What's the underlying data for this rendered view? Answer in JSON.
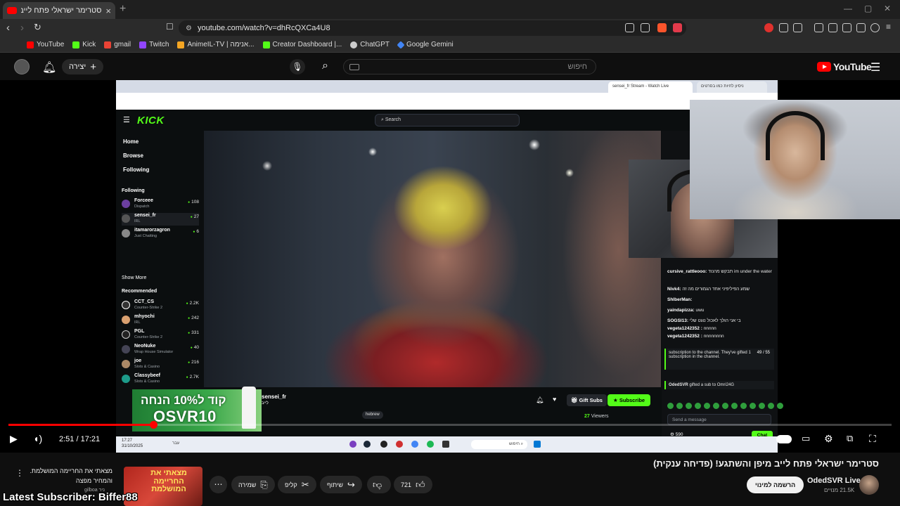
{
  "browser": {
    "tab_title": "סטרימר ישראלי פתח לייב מיפן ו",
    "url": "youtube.com/watch?v=dhRcQXCa4U8",
    "bookmarks": [
      {
        "label": "YouTube",
        "color": "#ff0000"
      },
      {
        "label": "Kick",
        "color": "#53fc18"
      },
      {
        "label": "gmail",
        "color": "#ea4335"
      },
      {
        "label": "Twitch",
        "color": "#9146ff"
      },
      {
        "label": "AnimeIL-TV | אנימה...",
        "color": "#f5a623"
      },
      {
        "label": "Creator Dashboard |...",
        "color": "#53fc18"
      },
      {
        "label": "ChatGPT",
        "color": "#cccccc"
      },
      {
        "label": "Google Gemini",
        "color": "#4285f4"
      }
    ]
  },
  "yt_header": {
    "create_label": "יצירה",
    "search_placeholder": "חיפוש",
    "logo_text": "YouTube"
  },
  "kick": {
    "logo": "KICK",
    "search_placeholder": "Search",
    "nav": [
      "Home",
      "Browse",
      "Following"
    ],
    "following_title": "Following",
    "following": [
      {
        "name": "Forceee",
        "cat": "Dispatch",
        "viewers": "108"
      },
      {
        "name": "sensei_fr",
        "cat": "IRL",
        "viewers": "27"
      },
      {
        "name": "itamarorzagron",
        "cat": "Just Chatting",
        "viewers": "6"
      }
    ],
    "show_more": "Show More",
    "recommended_title": "Recommended",
    "recommended": [
      {
        "name": "CCT_CS",
        "cat": "Counter-Strike 2",
        "viewers": "2.2K"
      },
      {
        "name": "mhyochi",
        "cat": "IRL",
        "viewers": "242"
      },
      {
        "name": "PGL",
        "cat": "Counter-Strike 2",
        "viewers": "331"
      },
      {
        "name": "NeoNuke",
        "cat": "Wrap House Simulator",
        "viewers": "40"
      },
      {
        "name": "joe",
        "cat": "Slots & Casino",
        "viewers": "216"
      },
      {
        "name": "Classybeef",
        "cat": "Slots & Casino",
        "viewers": "2.7K"
      }
    ],
    "streamer": "sensei_fr",
    "live_label": "לייב",
    "tags": [
      "hebrew"
    ],
    "gift_subs": "Gift Subs",
    "subscribe": "Subscribe",
    "viewers": "27",
    "viewers_label": "Viewers",
    "chat": [
      {
        "user": "cursive_rattleooo:",
        "msg": "תבקש מהנוד im under the water"
      },
      {
        "user": "Nivk4:",
        "msg": "שמע הפיליפיני אחד הגמורים מה זה"
      },
      {
        "user": "ShlberMan:",
        "msg": ""
      },
      {
        "user": "yaindapizza:",
        "msg": "uwu"
      },
      {
        "user": "SOGSI13:",
        "msg": "בי אני הולך לאכול נוגט שלי"
      },
      {
        "user": "vegeta1242352 :",
        "msg": "nnnnn"
      },
      {
        "user": "vegeta1242352 :",
        "msg": "nnnnnnnn"
      }
    ],
    "sub_notice": "subscription to the channel. They've gifted 1 subscription in the channel.",
    "sub_progress": "49 / 55",
    "gift_notice_user": "OdedSVR",
    "gift_notice": "gifted a sub to Omri24G",
    "send_placeholder": "Send a message",
    "chat_button": "Chat",
    "points": "590"
  },
  "promo": {
    "line1": "קוד ל10% הנחה",
    "line2": "OSVR10"
  },
  "taskbar": {
    "time": "17:27",
    "date": "31/10/2025",
    "search": "חיפוש",
    "lang": "עבר"
  },
  "player": {
    "current_time": "2:51",
    "duration": "17:21",
    "progress_fraction": 0.1643
  },
  "video": {
    "title": "סטרימר ישראלי פתח לייב מיפן והשתגע! (פדיחה ענקית)",
    "channel": "OdedSVR Live",
    "subs": "21.5K מנויים",
    "join_label": "הרשמה למינוי",
    "likes": "721",
    "share_label": "שיתוף",
    "clip_label": "קליפ",
    "save_label": "שמירה"
  },
  "recommended_video": {
    "thumb_text": "מצאתי את החריימה המושלמת",
    "title_line1": "מצאתי את החריימה המושלמת.",
    "title_line2": "והמחיר מפצה",
    "channel": "gilboa ניר"
  },
  "overlay": {
    "latest_sub": "Latest Subscriber: Biffer88"
  }
}
